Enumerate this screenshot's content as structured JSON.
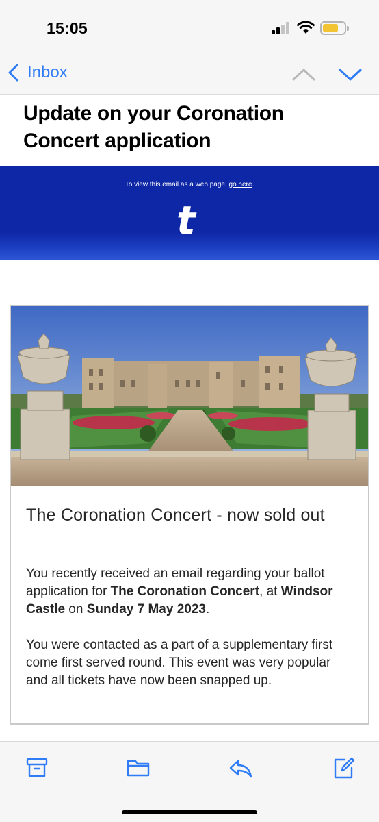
{
  "status_bar": {
    "time": "15:05",
    "battery_level": 0.65,
    "battery_color": "#f2c434",
    "signal_bars_active": 2,
    "signal_bars_total": 4
  },
  "nav": {
    "back_label": "Inbox",
    "icons": [
      "chevron-left-icon",
      "chevron-up-icon",
      "chevron-down-icon"
    ],
    "accent_color": "#2f7cf6"
  },
  "email": {
    "subject": "Update on your Coronation Concert application",
    "header": {
      "web_view_text": "To view this email as a web page,",
      "web_view_link": "go here",
      "web_view_suffix": ".",
      "logo_letter": "t",
      "brand_color": "#0e27a6"
    },
    "card": {
      "title": "The Coronation Concert - now sold out",
      "para1": {
        "text1": "You recently received an email regarding your ballot application for ",
        "bold1": "The Coronation Concert",
        "text2": ", at ",
        "bold2": "Windsor Castle",
        "text3": " on ",
        "bold3": "Sunday 7 May 2023",
        "text4": "."
      },
      "para2": "You were contacted as a part of a supplementary first come first served round. This event was very popular and all tickets have now been snapped up."
    }
  },
  "toolbar": {
    "icons": [
      "archive-icon",
      "folder-icon",
      "reply-icon",
      "compose-icon"
    ]
  }
}
